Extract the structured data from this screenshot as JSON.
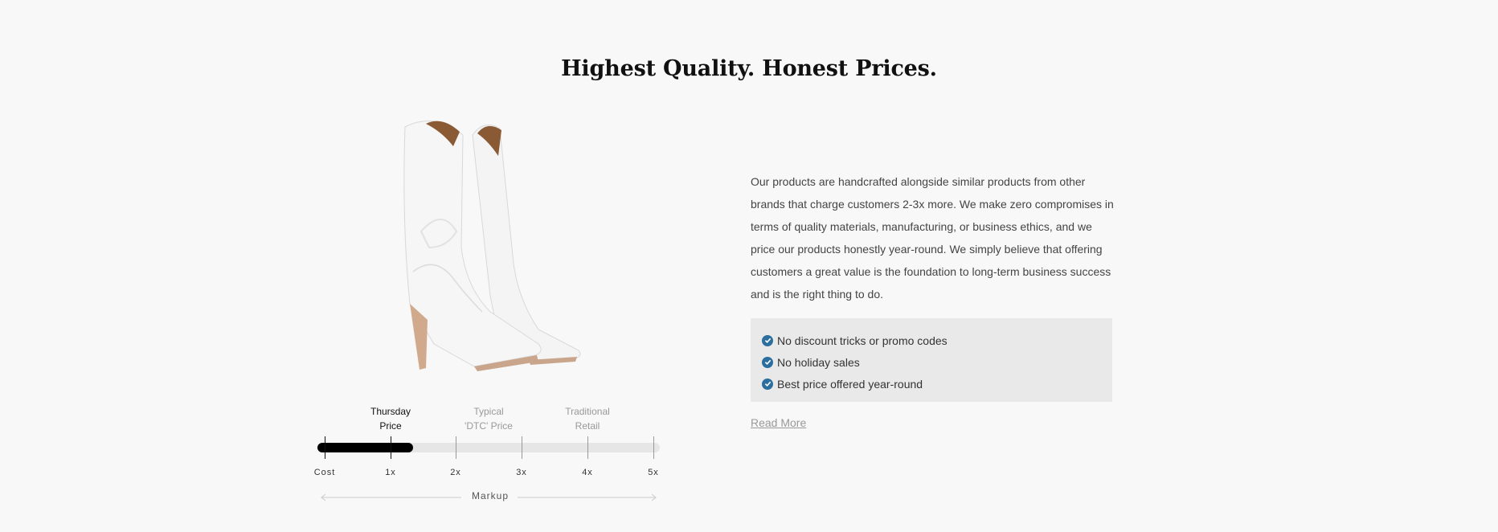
{
  "heading": "Highest Quality. Honest Prices.",
  "product_image": {
    "alt": "White western boots"
  },
  "price_scale": {
    "labels": [
      {
        "line1": "Thursday",
        "line2": "Price"
      },
      {
        "line1": "Typical",
        "line2": "'DTC' Price"
      },
      {
        "line1": "Traditional",
        "line2": "Retail"
      }
    ],
    "ticks": [
      "Cost",
      "1x",
      "2x",
      "3x",
      "4x",
      "5x"
    ],
    "fill_fraction": 0.28,
    "axis_label": "Markup"
  },
  "description": "Our products are handcrafted alongside similar products from other brands that charge customers 2-3x more. We make zero compromises in terms of quality materials, manufacturing, or business ethics, and we price our products honestly year-round. We simply believe that offering customers a great value is the foundation to long-term business success and is the right thing to do.",
  "benefits": [
    "No discount tricks or promo codes",
    "No holiday sales",
    "Best price offered year-round"
  ],
  "read_more": "Read More",
  "colors": {
    "check": "#2c6e9e",
    "fill": "#000000",
    "track": "#e6e6e6",
    "benefits_bg": "#e9e9e9"
  }
}
